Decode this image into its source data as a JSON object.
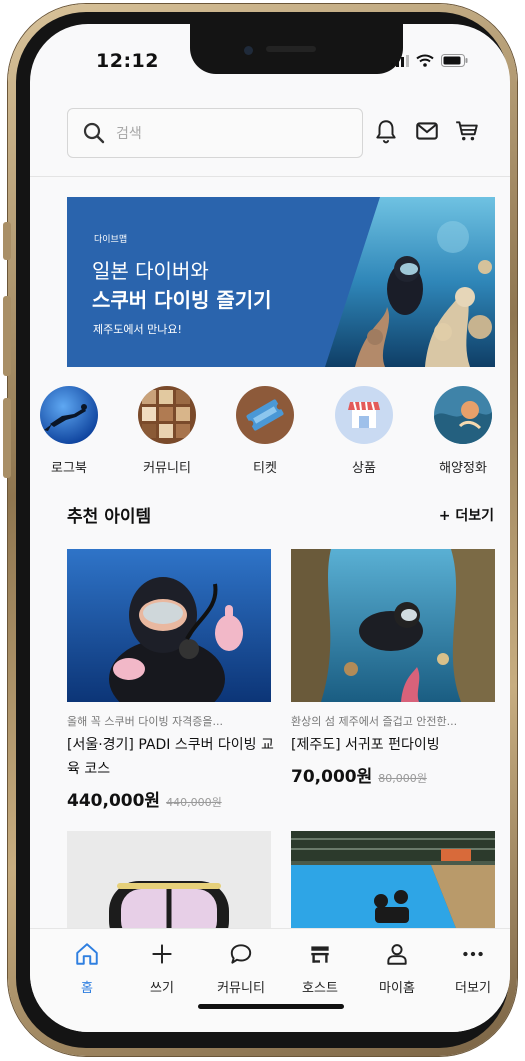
{
  "status": {
    "time": "12:12"
  },
  "search": {
    "placeholder": "검색"
  },
  "banner": {
    "brand": "다이브맵",
    "line1": "일본 다이버와",
    "line2": "스쿠버 다이빙 즐기기",
    "sub": "제주도에서 만나요!"
  },
  "categories": [
    {
      "label": "로그북",
      "icon": "diver-silhouette"
    },
    {
      "label": "커뮤니티",
      "icon": "community-collage"
    },
    {
      "label": "티켓",
      "icon": "ticket"
    },
    {
      "label": "상품",
      "icon": "storefront"
    },
    {
      "label": "해양정화",
      "icon": "ocean"
    }
  ],
  "recommend": {
    "title": "추천 아이템",
    "more": "+ 더보기",
    "cards": [
      {
        "subtitle": "올해 꼭 스쿠버 다이빙 자격증을...",
        "title": "[서울·경기] PADI 스쿠버 다이빙 교육 코스",
        "price": "440,000원",
        "old_price": "440,000원"
      },
      {
        "subtitle": "환상의 섬 제주에서 즐겁고 안전한...",
        "title": "[제주도] 서귀포 펀다이빙",
        "price": "70,000원",
        "old_price": "80,000원"
      }
    ]
  },
  "tabs": [
    {
      "label": "홈",
      "icon": "home-icon",
      "active": true
    },
    {
      "label": "쓰기",
      "icon": "plus-icon"
    },
    {
      "label": "커뮤니티",
      "icon": "chat-icon"
    },
    {
      "label": "호스트",
      "icon": "store-icon"
    },
    {
      "label": "마이홈",
      "icon": "person-icon"
    },
    {
      "label": "더보기",
      "icon": "more-icon"
    }
  ],
  "colors": {
    "accent": "#2a64ad",
    "active_tab": "#2f7fe0"
  }
}
